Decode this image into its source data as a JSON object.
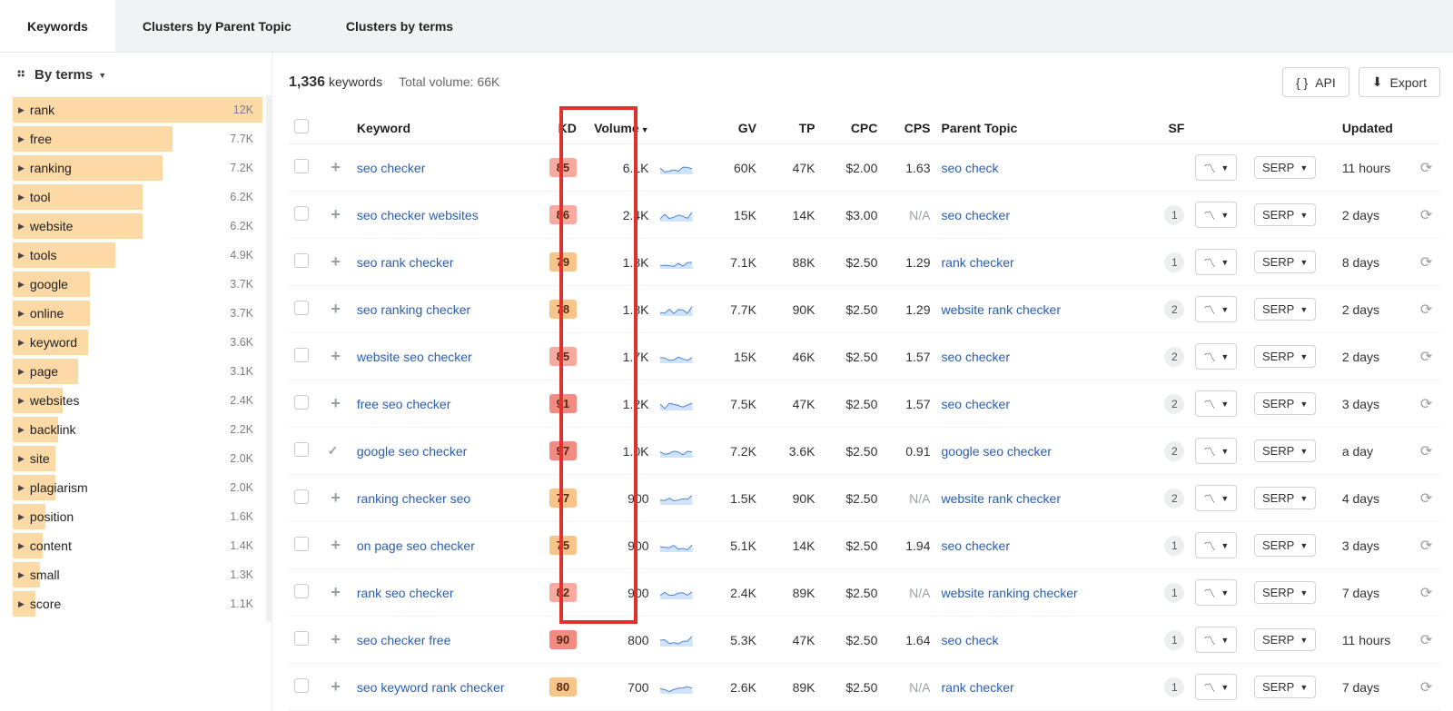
{
  "tabs": [
    {
      "label": "Keywords",
      "active": true
    },
    {
      "label": "Clusters by Parent Topic",
      "active": false
    },
    {
      "label": "Clusters by terms",
      "active": false
    }
  ],
  "byterms_label": "By terms",
  "sidebar_terms": [
    {
      "term": "rank",
      "count": "12K",
      "ratio": 1.0
    },
    {
      "term": "free",
      "count": "7.7K",
      "ratio": 0.64
    },
    {
      "term": "ranking",
      "count": "7.2K",
      "ratio": 0.6
    },
    {
      "term": "tool",
      "count": "6.2K",
      "ratio": 0.52
    },
    {
      "term": "website",
      "count": "6.2K",
      "ratio": 0.52
    },
    {
      "term": "tools",
      "count": "4.9K",
      "ratio": 0.41
    },
    {
      "term": "google",
      "count": "3.7K",
      "ratio": 0.31
    },
    {
      "term": "online",
      "count": "3.7K",
      "ratio": 0.31
    },
    {
      "term": "keyword",
      "count": "3.6K",
      "ratio": 0.3
    },
    {
      "term": "page",
      "count": "3.1K",
      "ratio": 0.26
    },
    {
      "term": "websites",
      "count": "2.4K",
      "ratio": 0.2
    },
    {
      "term": "backlink",
      "count": "2.2K",
      "ratio": 0.18
    },
    {
      "term": "site",
      "count": "2.0K",
      "ratio": 0.17
    },
    {
      "term": "plagiarism",
      "count": "2.0K",
      "ratio": 0.17
    },
    {
      "term": "position",
      "count": "1.6K",
      "ratio": 0.13
    },
    {
      "term": "content",
      "count": "1.4K",
      "ratio": 0.12
    },
    {
      "term": "small",
      "count": "1.3K",
      "ratio": 0.11
    },
    {
      "term": "score",
      "count": "1.1K",
      "ratio": 0.09
    }
  ],
  "summary": {
    "count": "1,336",
    "count_label": "keywords",
    "total_vol_label": "Total volume:",
    "total_vol": "66K"
  },
  "buttons": {
    "api": "API",
    "export": "Export"
  },
  "columns": {
    "keyword": "Keyword",
    "kd": "KD",
    "volume": "Volume",
    "gv": "GV",
    "tp": "TP",
    "cpc": "CPC",
    "cps": "CPS",
    "parent": "Parent Topic",
    "sf": "SF",
    "updated": "Updated",
    "serp": "SERP"
  },
  "kd_colors": {
    "red": "#f8a9a0",
    "amber": "#f7c58a",
    "deepred": "#f28b82"
  },
  "rows": [
    {
      "kw": "seo checker",
      "kd": 85,
      "kdc": "red",
      "vol": "6.1K",
      "gv": "60K",
      "tp": "47K",
      "cpc": "$2.00",
      "cps": "1.63",
      "parent": "seo check",
      "sf": "",
      "upd": "11 hours",
      "mark": "+"
    },
    {
      "kw": "seo checker websites",
      "kd": 86,
      "kdc": "red",
      "vol": "2.4K",
      "gv": "15K",
      "tp": "14K",
      "cpc": "$3.00",
      "cps": "N/A",
      "parent": "seo checker",
      "sf": "1",
      "upd": "2 days",
      "mark": "+"
    },
    {
      "kw": "seo rank checker",
      "kd": 79,
      "kdc": "amber",
      "vol": "1.8K",
      "gv": "7.1K",
      "tp": "88K",
      "cpc": "$2.50",
      "cps": "1.29",
      "parent": "rank checker",
      "sf": "1",
      "upd": "8 days",
      "mark": "+"
    },
    {
      "kw": "seo ranking checker",
      "kd": 78,
      "kdc": "amber",
      "vol": "1.8K",
      "gv": "7.7K",
      "tp": "90K",
      "cpc": "$2.50",
      "cps": "1.29",
      "parent": "website rank checker",
      "sf": "2",
      "upd": "2 days",
      "mark": "+"
    },
    {
      "kw": "website seo checker",
      "kd": 85,
      "kdc": "red",
      "vol": "1.7K",
      "gv": "15K",
      "tp": "46K",
      "cpc": "$2.50",
      "cps": "1.57",
      "parent": "seo checker",
      "sf": "2",
      "upd": "2 days",
      "mark": "+"
    },
    {
      "kw": "free seo checker",
      "kd": 91,
      "kdc": "deepred",
      "vol": "1.2K",
      "gv": "7.5K",
      "tp": "47K",
      "cpc": "$2.50",
      "cps": "1.57",
      "parent": "seo checker",
      "sf": "2",
      "upd": "3 days",
      "mark": "+"
    },
    {
      "kw": "google seo checker",
      "kd": 97,
      "kdc": "deepred",
      "vol": "1.0K",
      "gv": "7.2K",
      "tp": "3.6K",
      "cpc": "$2.50",
      "cps": "0.91",
      "parent": "google seo checker",
      "sf": "2",
      "upd": "a day",
      "mark": "✓"
    },
    {
      "kw": "ranking checker seo",
      "kd": 77,
      "kdc": "amber",
      "vol": "900",
      "gv": "1.5K",
      "tp": "90K",
      "cpc": "$2.50",
      "cps": "N/A",
      "parent": "website rank checker",
      "sf": "2",
      "upd": "4 days",
      "mark": "+"
    },
    {
      "kw": "on page seo checker",
      "kd": 75,
      "kdc": "amber",
      "vol": "900",
      "gv": "5.1K",
      "tp": "14K",
      "cpc": "$2.50",
      "cps": "1.94",
      "parent": "seo checker",
      "sf": "1",
      "upd": "3 days",
      "mark": "+"
    },
    {
      "kw": "rank seo checker",
      "kd": 82,
      "kdc": "red",
      "vol": "900",
      "gv": "2.4K",
      "tp": "89K",
      "cpc": "$2.50",
      "cps": "N/A",
      "parent": "website ranking checker",
      "sf": "1",
      "upd": "7 days",
      "mark": "+"
    },
    {
      "kw": "seo checker free",
      "kd": 90,
      "kdc": "deepred",
      "vol": "800",
      "gv": "5.3K",
      "tp": "47K",
      "cpc": "$2.50",
      "cps": "1.64",
      "parent": "seo check",
      "sf": "1",
      "upd": "11 hours",
      "mark": "+"
    },
    {
      "kw": "seo keyword rank checker",
      "kd": 80,
      "kdc": "amber",
      "vol": "700",
      "gv": "2.6K",
      "tp": "89K",
      "cpc": "$2.50",
      "cps": "N/A",
      "parent": "rank checker",
      "sf": "1",
      "upd": "7 days",
      "mark": "+"
    }
  ]
}
